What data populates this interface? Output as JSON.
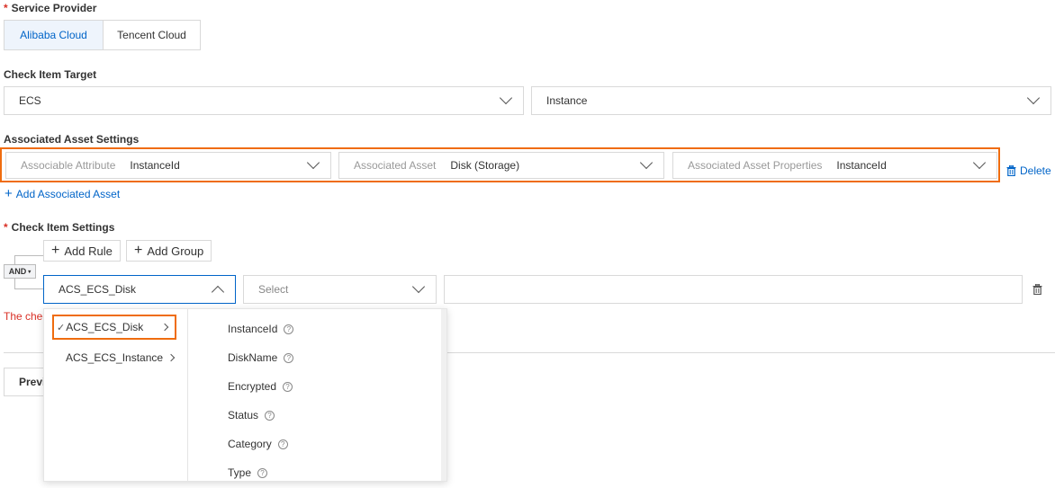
{
  "service_provider": {
    "label": "Service Provider",
    "required_mark": "*",
    "options": [
      "Alibaba Cloud",
      "Tencent Cloud"
    ],
    "selected": "Alibaba Cloud"
  },
  "check_item_target": {
    "label": "Check Item Target",
    "first_value": "ECS",
    "second_value": "Instance"
  },
  "associated_asset_settings": {
    "label": "Associated Asset Settings",
    "attr_placeholder": "Associable Attribute",
    "attr_value": "InstanceId",
    "asset_placeholder": "Associated Asset",
    "asset_value": "Disk (Storage)",
    "props_placeholder": "Associated Asset Properties",
    "props_value": "InstanceId",
    "delete_label": "Delete",
    "add_label": "Add Associated Asset"
  },
  "check_item_settings": {
    "label": "Check Item Settings",
    "required_mark": "*",
    "add_rule_label": "Add Rule",
    "add_group_label": "Add Group",
    "logic_label": "AND",
    "rule_field_value": "ACS_ECS_Disk",
    "operator_placeholder": "Select",
    "value_input": "",
    "error_text_visible": "The chec"
  },
  "footer": {
    "previous_label_visible": "Previ"
  },
  "dropdown": {
    "left_items": [
      {
        "label": "ACS_ECS_Disk",
        "checked": true
      },
      {
        "label": "ACS_ECS_Instance",
        "checked": false
      }
    ],
    "check_mark": "✓",
    "right_items": [
      {
        "label": "InstanceId"
      },
      {
        "label": "DiskName"
      },
      {
        "label": "Encrypted"
      },
      {
        "label": "Status"
      },
      {
        "label": "Category"
      },
      {
        "label": "Type"
      }
    ],
    "help_glyph": "?"
  },
  "colors": {
    "accent": "#0064c8",
    "highlight": "#ef6c0f",
    "error": "#d93026"
  }
}
